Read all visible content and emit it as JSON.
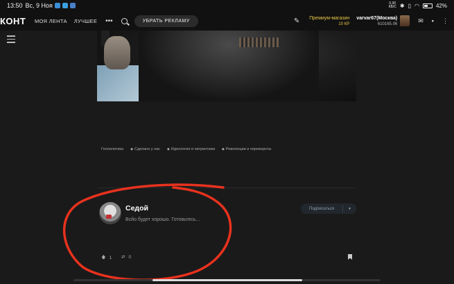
{
  "status_bar": {
    "time": "13:50",
    "date": "Вс, 9 Ноя",
    "net_speed_value": "0,00",
    "net_speed_unit": "КБ/С",
    "battery": "42%"
  },
  "nav": {
    "logo": "КОНТ",
    "items": [
      "МОЯ ЛЕНТА",
      "ЛУЧШЕЕ"
    ],
    "more": "•••",
    "ad_button": "УБРАТЬ РЕКЛАМУ",
    "premium_label": "Премиум-магазин",
    "premium_balance": "10 КР",
    "username": "varvar67(Москва)",
    "user_id": "610165.06"
  },
  "tags": [
    {
      "label": "Геополитика",
      "icon": false
    },
    {
      "label": "Сделано у нас",
      "icon": true
    },
    {
      "label": "Идеология и патриотизм",
      "icon": true
    },
    {
      "label": "Революции и перевороты",
      "icon": true
    }
  ],
  "author": {
    "name": "Седой",
    "description": "Всйо будет хорошо. Готовьтесь..."
  },
  "subscribe": {
    "label": "Подписаться"
  },
  "stats": {
    "upvotes": "1",
    "reposts": "0"
  },
  "colors": {
    "background": "#1a1a1a",
    "premium": "#e8c547",
    "annotation": "#e8321e"
  }
}
